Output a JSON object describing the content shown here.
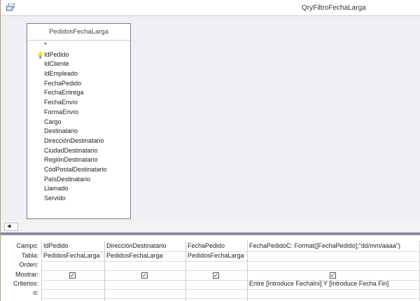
{
  "window": {
    "title": "QryFiltroFechaLarga",
    "icon": "query-window-icon"
  },
  "table": {
    "name": "PedidosFechaLarga",
    "fields": [
      "*",
      "IdPedido",
      "IdCliente",
      "IdEmpleado",
      "FechaPedido",
      "FechaEntrega",
      "FechaEnvío",
      "FormaEnvío",
      "Cargo",
      "Destinatario",
      "DirecciónDestinatario",
      "CiudadDestinatario",
      "RegiónDestinatario",
      "CódPostalDestinatario",
      "PaísDestinatario",
      "Llamado",
      "Servido"
    ],
    "primary_key": "IdPedido"
  },
  "grid": {
    "row_labels": {
      "campo": "Campo:",
      "tabla": "Tabla:",
      "orden": "Orden:",
      "mostrar": "Mostrar:",
      "criterios": "Criterios:",
      "o": "o:"
    },
    "columns": [
      {
        "campo": "IdPedido",
        "tabla": "PedidosFechaLarga",
        "mostrar": true,
        "criterios": ""
      },
      {
        "campo": "DirecciónDestinatario",
        "tabla": "PedidosFechaLarga",
        "mostrar": true,
        "criterios": ""
      },
      {
        "campo": "FechaPedido",
        "tabla": "PedidosFechaLarga",
        "mostrar": true,
        "criterios": ""
      },
      {
        "campo": "FechaPedidoC: Format([FechaPedido];\"dd/mm/aaaa\")",
        "tabla": "",
        "mostrar": true,
        "criterios": "Entre [Introduce FechaIni] Y [Introduce Fecha Fin]"
      }
    ]
  }
}
